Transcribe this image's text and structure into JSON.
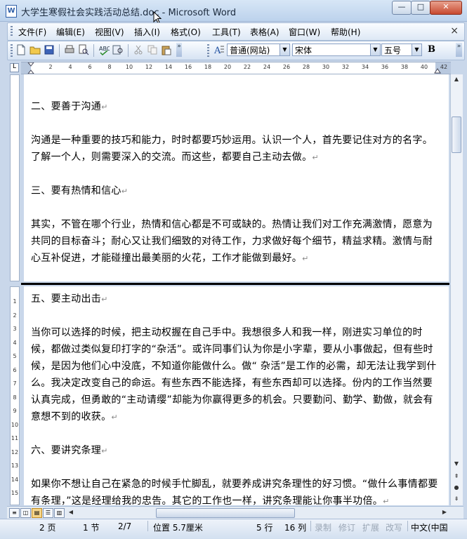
{
  "window": {
    "title": "大学生寒假社会实践活动总结.doc - Microsoft Word",
    "app_icon": "W",
    "controls": {
      "minimize": "—",
      "maximize": "□",
      "close": "✕"
    }
  },
  "menu": {
    "items": [
      "文件(F)",
      "编辑(E)",
      "视图(V)",
      "插入(I)",
      "格式(O)",
      "工具(T)",
      "表格(A)",
      "窗口(W)",
      "帮助(H)"
    ],
    "close_glyph": "×"
  },
  "toolbar": {
    "style_value": "普通(网站)",
    "font_value": "宋体",
    "size_value": "五号",
    "bold_label": "B",
    "icons": [
      "new-document-icon",
      "open-folder-icon",
      "save-icon",
      "print-icon",
      "print-preview-icon",
      "spelling-check-icon",
      "research-icon",
      "cut-icon",
      "copy-icon",
      "paste-icon",
      "styles-icon"
    ]
  },
  "ruler": {
    "ticks": [
      "2",
      "4",
      "6",
      "8",
      "10",
      "12",
      "14",
      "16",
      "18",
      "20",
      "22",
      "24",
      "26",
      "28",
      "30",
      "32",
      "34",
      "36",
      "38",
      "40",
      "42"
    ],
    "tab_selector": "L",
    "vertical_ticks": [
      "1",
      "2",
      "3",
      "4",
      "5",
      "6",
      "7",
      "8",
      "9",
      "10",
      "11",
      "12",
      "13",
      "14",
      "15"
    ]
  },
  "document": {
    "pilcrow": "↵",
    "pane_top": [
      {
        "text": "二、要善于沟通"
      },
      {
        "text": "沟通是一种重要的技巧和能力，时时都要巧妙运用。认识一个人，首先要记住对方的名字。了解一个人，则需要深入的交流。而这些，都要自己主动去做。"
      },
      {
        "text": "三、要有热情和信心"
      },
      {
        "text": "其实，不管在哪个行业，热情和信心都是不可或缺的。热情让我们对工作充满激情，愿意为共同的目标奋斗；耐心又让我们细致的对待工作，力求做好每个细节，精益求精。激情与耐心互补促进，才能碰撞出最美丽的火花，工作才能做到最好。"
      }
    ],
    "pane_bottom": [
      {
        "text": "五、要主动出击"
      },
      {
        "text": "当你可以选择的时候，把主动权握在自己手中。我想很多人和我一样，刚进实习单位的时候，都做过类似复印打字的“杂活”。或许同事们认为你是小字辈，要从小事做起，但有些时候，是因为他们心中没底，不知道你能做什么。做“ 杂活”是工作的必需，却无法让我学到什么。我决定改变自己的命运。有些东西不能选择，有些东西却可以选择。份内的工作当然要认真完成，但勇敢的“主动请缨”却能为你赢得更多的机会。只要勤问、勤学、勤做，就会有意想不到的收获。"
      },
      {
        "text": "六、要讲究条理"
      },
      {
        "text": "如果你不想让自己在紧急的时候手忙脚乱，就要养成讲究条理性的好习惯。“做什么事情都要有条理，”这是经理给我的忠告。其它的工作也一样，讲究条理能让你事半功倍。"
      }
    ]
  },
  "status": {
    "page": "2 页",
    "section": "1 节",
    "pages": "2/7",
    "position": "位置 5.7厘米",
    "line": "5 行",
    "column": "16 列",
    "rec": "录制",
    "trk": "修订",
    "ext": "扩展",
    "ovr": "改写",
    "language": "中文(中国"
  }
}
